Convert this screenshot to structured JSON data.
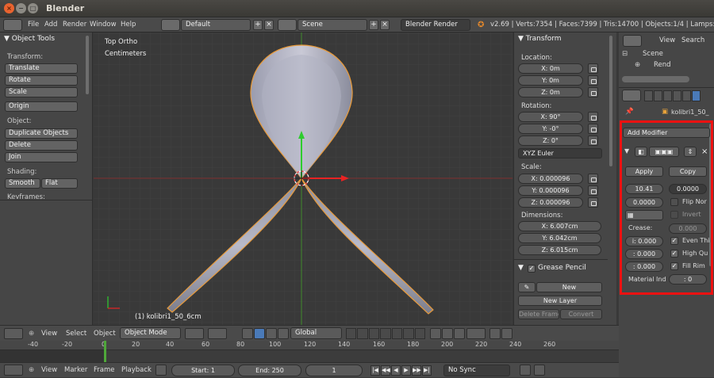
{
  "window": {
    "title": "Blender",
    "close": "×",
    "min": "−",
    "max": "□"
  },
  "infobar": {
    "menus": [
      "File",
      "Add",
      "Render",
      "Window",
      "Help"
    ],
    "layout": "Default",
    "scene": "Scene",
    "engine": "Blender Render",
    "stats": "v2.69 | Verts:7354 | Faces:7399 | Tris:14700 | Objects:1/4 | Lamps:0/1 | M"
  },
  "toolshelf": {
    "title": "▼ Object Tools",
    "transform_label": "Transform:",
    "translate": "Translate",
    "rotate": "Rotate",
    "scale": "Scale",
    "origin": "Origin",
    "object_label": "Object:",
    "duplicate": "Duplicate Objects",
    "delete": "Delete",
    "join": "Join",
    "shading_label": "Shading:",
    "smooth": "Smooth",
    "flat": "Flat",
    "keyframes_label": "Keyframes:"
  },
  "viewport": {
    "view_name": "Top Ortho",
    "units": "Centimeters",
    "object_label": "(1) kolibri1_50_6cm"
  },
  "npanel": {
    "title": "▼ Transform",
    "location_label": "Location:",
    "loc_x": "X: 0m",
    "loc_y": "Y: 0m",
    "loc_z": "Z: 0m",
    "rotation_label": "Rotation:",
    "rot_x": "X: 90°",
    "rot_y": "Y: -0°",
    "rot_z": "Z: 0°",
    "rot_mode": "XYZ Euler",
    "scale_label": "Scale:",
    "scale_x": "X: 0.000096",
    "scale_y": "Y: 0.000096",
    "scale_z": "Z: 0.000096",
    "dims_label": "Dimensions:",
    "dim_x": "X: 6.007cm",
    "dim_y": "Y: 6.042cm",
    "dim_z": "Z: 6.015cm",
    "grease_title": "Grease Pencil",
    "gp_new": "New",
    "gp_new_layer": "New Layer",
    "gp_delete_frame": "Delete Frame",
    "gp_convert": "Convert"
  },
  "outliner": {
    "view": "View",
    "search": "Search",
    "scene": "Scene",
    "render": "Rend"
  },
  "properties": {
    "object_name": "kolibri1_50_",
    "add_modifier": "Add Modifier",
    "apply": "Apply",
    "copy": "Copy",
    "thickness": "10.41",
    "offset": "0.0000",
    "flip_normals": "Flip Nor",
    "factor": "0.0000",
    "invert": "Invert",
    "crease_label": "Crease:",
    "crease_val": "0.000",
    "crease_inner": "i: 0.000",
    "crease_outer": ": 0.000",
    "crease_rim": ": 0.000",
    "even_thickness": "Even Thi",
    "high_quality": "High Qu",
    "fill_rim": "Fill Rim",
    "material_label": "Material Ind",
    "material_val": ": 0"
  },
  "vpheader": {
    "view": "View",
    "select": "Select",
    "object": "Object",
    "mode": "Object Mode",
    "orientation": "Global"
  },
  "timeline": {
    "ticks": [
      "-40",
      "-20",
      "0",
      "20",
      "40",
      "60",
      "80",
      "100",
      "120",
      "140",
      "160",
      "180",
      "200",
      "220",
      "240",
      "260"
    ],
    "view": "View",
    "marker": "Marker",
    "frame": "Frame",
    "playback": "Playback",
    "start": "Start: 1",
    "end": "End: 250",
    "current": "1",
    "sync": "No Sync"
  },
  "colors": {
    "highlight": "#ee1111",
    "selected_outline": "#e89a3a",
    "x_axis": "#8a2d2d",
    "y_axis": "#4a9a2a"
  }
}
